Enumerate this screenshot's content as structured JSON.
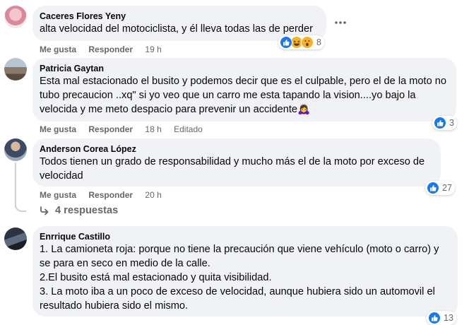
{
  "comments": [
    {
      "author": "Caceres Flores Yeny",
      "text": "alta velocidad del motociclista, y él lleva todas las de perder",
      "like_label": "Me gusta",
      "reply_label": "Responder",
      "time": "19 h",
      "reaction_count": "8",
      "reaction_icons": [
        "like-icon",
        "haha-icon",
        "wow-icon"
      ]
    },
    {
      "author": "Patricia Gaytan",
      "text": "Esta mal estacionado el busito y podemos decir que es el culpable, pero el de la moto no tubo precaucion ..xq\" si yo veo que un carro me esta tapando la vision....yo bajo la velocida y me meto despacio para prevenir un accidente🙇‍♀️",
      "like_label": "Me gusta",
      "reply_label": "Responder",
      "time": "18 h",
      "edited_label": "Editado",
      "reaction_count": "3",
      "reaction_icons": [
        "like-icon"
      ]
    },
    {
      "author": "Anderson Corea López",
      "text": "Todos tienen un grado de responsabilidad y mucho más el de la moto por exceso de velocidad",
      "like_label": "Me gusta",
      "reply_label": "Responder",
      "time": "20 h",
      "reaction_count": "27",
      "reaction_icons": [
        "like-icon"
      ],
      "replies_label": "4 respuestas"
    },
    {
      "author": "Enrrique Castillo",
      "lines": [
        "1. La camioneta roja: porque no tiene la precaución que viene vehículo (moto o carro) y se para en seco en medio de la calle.",
        "2.El busito está mal estacionado y quita visibilidad.",
        "3. La moto iba a un poco de exceso de velocidad, aunque hubiera sido un automovil el resultado hubiera sido el mismo."
      ],
      "reaction_count": "13",
      "reaction_icons": [
        "like-icon"
      ]
    }
  ],
  "colors": {
    "bubble": "#f0f2f5",
    "meta_text": "#65676b",
    "like_blue": "#1877f2",
    "thread_line": "#ced0d4"
  }
}
